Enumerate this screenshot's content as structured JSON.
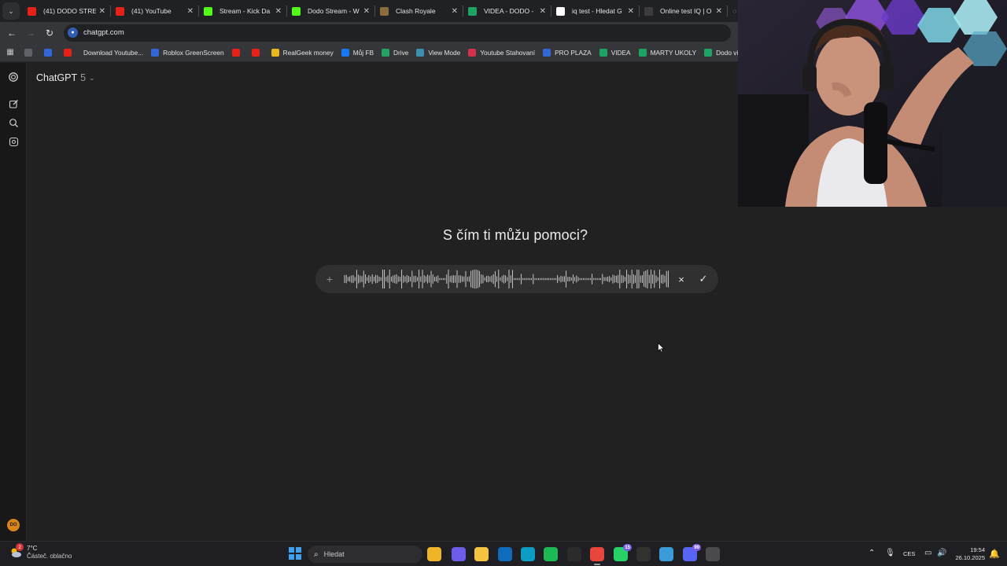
{
  "browser": {
    "tabs": [
      {
        "title": "(41) DODO STREA",
        "favicon": "youtube-icon",
        "color": "#e62117"
      },
      {
        "title": "(41) YouTube",
        "favicon": "youtube-icon",
        "color": "#e62117"
      },
      {
        "title": "Stream - Kick Da",
        "favicon": "kick-icon",
        "color": "#53fc18"
      },
      {
        "title": "Dodo Stream - W",
        "favicon": "kick-icon",
        "color": "#53fc18"
      },
      {
        "title": "Clash Royale",
        "favicon": "clash-royale-icon",
        "color": "#8a6d3b"
      },
      {
        "title": "VIDEA - DODO - ",
        "favicon": "sheets-icon",
        "color": "#1ea362"
      },
      {
        "title": "iq test - Hledat G",
        "favicon": "google-icon",
        "color": "#ffffff"
      },
      {
        "title": "Online test IQ | O",
        "favicon": "loading-icon",
        "color": "#3c3c3c"
      }
    ],
    "url": "chatgpt.com",
    "bookmarks": [
      {
        "label": "",
        "icon": "globe-icon",
        "color": "#5f6368"
      },
      {
        "label": "",
        "icon": "roblox-icon",
        "color": "#3367d6"
      },
      {
        "label": "",
        "icon": "youtube-icon",
        "color": "#e62117"
      },
      {
        "label": "Download Youtube...",
        "icon": "",
        "color": ""
      },
      {
        "label": "Roblox GreenScreen",
        "icon": "roblox-icon",
        "color": "#3367d6"
      },
      {
        "label": "",
        "icon": "youtube-icon",
        "color": "#e62117"
      },
      {
        "label": "",
        "icon": "youtube-icon",
        "color": "#e62117"
      },
      {
        "label": "RealGeek money",
        "icon": "coin-icon",
        "color": "#e8b81f"
      },
      {
        "label": "Můj FB",
        "icon": "facebook-icon",
        "color": "#1877f2"
      },
      {
        "label": "Drive",
        "icon": "drive-icon",
        "color": "#1fa463"
      },
      {
        "label": "View Mode",
        "icon": "view-mode-icon",
        "color": "#3c8fb0"
      },
      {
        "label": "Youtube Stahovaní",
        "icon": "download-icon",
        "color": "#d5304a"
      },
      {
        "label": "PRO PLAZA",
        "icon": "roblox-icon",
        "color": "#3367d6"
      },
      {
        "label": "VIDEA",
        "icon": "sheets-icon",
        "color": "#1ea362"
      },
      {
        "label": "MARTY UKOLY",
        "icon": "sheets-icon",
        "color": "#1ea362"
      },
      {
        "label": "Dodo videa",
        "icon": "drive-icon",
        "color": "#1fa463"
      }
    ]
  },
  "chatgpt": {
    "model_name": "ChatGPT",
    "model_version": "5",
    "headline": "S čím ti můžu pomoci?",
    "avatar_initials": "DO",
    "composer": {
      "mode": "voice-dictation",
      "plus_label": "+",
      "cancel_label": "×",
      "confirm_label": "✓"
    }
  },
  "taskbar": {
    "weather": {
      "temp": "7°C",
      "desc": "Částeč. oblačno",
      "alert_count": "2"
    },
    "search_placeholder": "Hledat",
    "language": "CES",
    "time": "19:54",
    "date": "26.10.2025",
    "apps": [
      {
        "name": "file-explorer-icon",
        "color": "#f0b429",
        "badge": ""
      },
      {
        "name": "copilot-icon",
        "color": "#6c5ce7",
        "badge": ""
      },
      {
        "name": "folder-icon",
        "color": "#f5c542",
        "badge": ""
      },
      {
        "name": "outlook-icon",
        "color": "#0f6cbd",
        "badge": ""
      },
      {
        "name": "edge-icon",
        "color": "#0c9dc5",
        "badge": ""
      },
      {
        "name": "spotify-icon",
        "color": "#1db954",
        "badge": ""
      },
      {
        "name": "capcut-icon",
        "color": "#2b2b2b",
        "badge": ""
      },
      {
        "name": "chrome-icon",
        "color": "#e8453c",
        "badge": ""
      },
      {
        "name": "whatsapp-icon",
        "color": "#25d366",
        "badge": "15"
      },
      {
        "name": "epic-games-icon",
        "color": "#313131",
        "badge": ""
      },
      {
        "name": "f-app-icon",
        "color": "#3a9bd9",
        "badge": ""
      },
      {
        "name": "discord-icon",
        "color": "#5865f2",
        "badge": "99"
      },
      {
        "name": "calculator-icon",
        "color": "#4a4a4f",
        "badge": ""
      }
    ]
  }
}
